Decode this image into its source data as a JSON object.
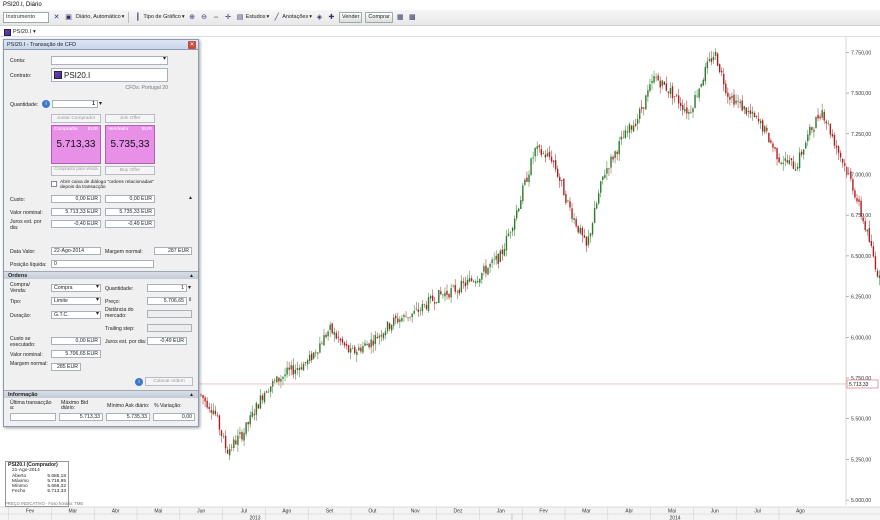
{
  "window": {
    "title": "PSI20.I, Diário"
  },
  "toolbar": {
    "instrument_placeholder": "Instrumento",
    "period": "Diário, Automático",
    "chart_type": "Tipo de Gráfico",
    "studies": "Estudos",
    "annotations": "Anotações",
    "sell": "Vender",
    "buy": "Comprar"
  },
  "tab": {
    "label": "PSI20.I"
  },
  "panel": {
    "title": "PSI20.I - Transação de CFD",
    "account_label": "Conta:",
    "contract_label": "Contrato:",
    "contract_value": "PSI20.I",
    "contract_desc": "CFDs: Portugal 20",
    "quantity_label": "Quantidade:",
    "quantity_value": "1",
    "join_buyer": "Juntar Comprador",
    "join_offer": "Join Offer",
    "buyer_label": "Comprador",
    "seller_label": "Vendedor",
    "currency": "EUR",
    "bid": "5.713,33",
    "ask": "5.735,33",
    "buy_from": "Comprador para Venda",
    "buy_offer": "Buy Offer",
    "checkbox_text": "Abrir caixa de diálogo \"ordens relacionadas\" depois da transacção",
    "cost_label": "Custo:",
    "cost_bid": "0,00 EUR",
    "cost_ask": "0,00 EUR",
    "nominal_label": "Valor nominal:",
    "nominal_bid": "5.713,33 EUR",
    "nominal_ask": "5.735,33 EUR",
    "interest_label": "Juros est. por dia:",
    "interest_bid": "-0,40 EUR",
    "interest_ask": "-0,49 EUR",
    "value_date_label": "Data Valor:",
    "value_date": "22-Ago-2014",
    "margin_label": "Margem normal:",
    "margin_value": "287 EUR",
    "net_position_label": "Posição líquida:",
    "net_position_value": "0",
    "orders_section": "Ordens",
    "buysell_label": "Compra/ Venda:",
    "buysell_value": "Compra",
    "type_label": "Tipo:",
    "type_value": "Limite",
    "duration_label": "Duração:",
    "duration_value": "G.T.C.",
    "qty_label": "Quantidade:",
    "qty_value": "1",
    "price_label": "Preço:",
    "price_value": "5.706,65",
    "market_dist_label": "Distância do mercado:",
    "trailing_label": "Trailing step:",
    "exec_cost_label": "Custo se executado:",
    "exec_cost_value": "0,00 EUR",
    "interest2_label": "Juros est. por dia:",
    "interest2_value": "-0,49 EUR",
    "nominal2_label": "Valor nominal:",
    "nominal2_value": "5.706,65 EUR",
    "margin2_label": "Margem normal:",
    "margin2_value": "285 EUR",
    "place_order": "Colocar ordem",
    "info_section": "Informação",
    "last_trade_label": "Última transacção a:",
    "max_bid_label": "Máximo Bid diário:",
    "max_bid_value": "5.713,33",
    "min_ask_label": "Mínimo Ask diário:",
    "min_ask_value": "5.735,33",
    "pct_var_label": "% Variação:",
    "pct_var_value": "0,00"
  },
  "info_box": {
    "title": "PSI20.I (Comprador)",
    "date": "21-Ago-2014",
    "rows": [
      {
        "k": "Aberto",
        "v": "5.685,18"
      },
      {
        "k": "Máximo",
        "v": "5.718,95"
      },
      {
        "k": "Mínimo",
        "v": "5.666,32"
      },
      {
        "k": "Fecho",
        "v": "5.713,33"
      }
    ],
    "source": "PREÇO INDICATIVO · Fuso horário: TMB"
  },
  "chart_data": {
    "type": "candlestick",
    "current_price_label": "5.713,33",
    "y_ticks": [
      "7.750,00",
      "7.500,00",
      "7.250,00",
      "7.000,00",
      "6.750,00",
      "6.500,00",
      "6.250,00",
      "6.000,00",
      "5.750,00",
      "5.500,00",
      "5.250,00",
      "5.000,00"
    ],
    "y_values": [
      7750,
      7500,
      7250,
      7000,
      6750,
      6500,
      6250,
      6000,
      5750,
      5500,
      5250,
      5000
    ],
    "ylim": [
      4970,
      7820
    ],
    "current_price": 5713.33,
    "x_ticks": [
      "Fev",
      "Mar",
      "Abr",
      "Mai",
      "Jun",
      "Jul",
      "Ago",
      "Set",
      "Out",
      "Nov",
      "Dez",
      "Jan",
      "Fev",
      "Mar",
      "Abr",
      "Mai",
      "Jun",
      "Jul",
      "Ago"
    ],
    "x_years": [
      "2013",
      "2014"
    ],
    "bull_color": "#2a7a2a",
    "bear_color": "#b01c1c",
    "trend": [
      [
        0,
        5650
      ],
      [
        0.6,
        5730
      ],
      [
        1.2,
        5580
      ],
      [
        1.8,
        5400
      ],
      [
        2.4,
        5520
      ],
      [
        3.0,
        5720
      ],
      [
        3.3,
        5780
      ],
      [
        3.8,
        5700
      ],
      [
        4.3,
        5550
      ],
      [
        4.6,
        5300
      ],
      [
        5.0,
        5420
      ],
      [
        5.5,
        5680
      ],
      [
        6.0,
        5780
      ],
      [
        6.5,
        5850
      ],
      [
        7.0,
        6050
      ],
      [
        7.5,
        5900
      ],
      [
        8.0,
        5980
      ],
      [
        8.5,
        6100
      ],
      [
        9.0,
        6150
      ],
      [
        9.5,
        6250
      ],
      [
        10.0,
        6300
      ],
      [
        10.5,
        6380
      ],
      [
        11.0,
        6500
      ],
      [
        11.4,
        6800
      ],
      [
        11.8,
        7150
      ],
      [
        12.2,
        7100
      ],
      [
        12.6,
        6800
      ],
      [
        13.0,
        6550
      ],
      [
        13.4,
        7000
      ],
      [
        13.8,
        7200
      ],
      [
        14.2,
        7350
      ],
      [
        14.6,
        7600
      ],
      [
        15.0,
        7500
      ],
      [
        15.4,
        7380
      ],
      [
        15.8,
        7650
      ],
      [
        16.0,
        7750
      ],
      [
        16.3,
        7500
      ],
      [
        16.7,
        7400
      ],
      [
        17.1,
        7300
      ],
      [
        17.5,
        7100
      ],
      [
        17.9,
        7050
      ],
      [
        18.2,
        7250
      ],
      [
        18.5,
        7400
      ],
      [
        18.8,
        7200
      ],
      [
        19.2,
        6950
      ],
      [
        19.6,
        6600
      ],
      [
        19.9,
        6300
      ],
      [
        20.3,
        6150
      ],
      [
        20.7,
        6250
      ],
      [
        21.0,
        6500
      ],
      [
        21.3,
        6100
      ],
      [
        21.6,
        5900
      ],
      [
        21.9,
        5750
      ],
      [
        22.2,
        5400
      ],
      [
        22.5,
        5280
      ],
      [
        22.8,
        5500
      ],
      [
        23.1,
        5650
      ],
      [
        23.3,
        5713
      ]
    ]
  }
}
